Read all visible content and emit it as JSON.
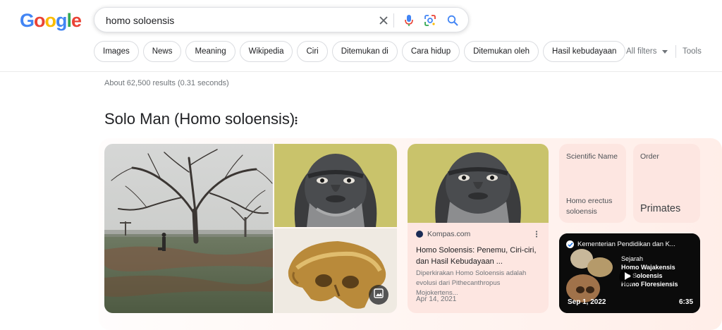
{
  "logo": {
    "letters": [
      "G",
      "o",
      "o",
      "g",
      "l",
      "e"
    ],
    "colors": [
      "#4285f4",
      "#ea4335",
      "#fbbc05",
      "#4285f4",
      "#34a853",
      "#ea4335"
    ]
  },
  "search": {
    "query": "homo soloensis"
  },
  "chips": [
    "Images",
    "News",
    "Meaning",
    "Wikipedia",
    "Ciri",
    "Ditemukan di",
    "Cara hidup",
    "Ditemukan oleh",
    "Hasil kebudayaan"
  ],
  "toolbar": {
    "all_filters": "All filters",
    "tools": "Tools"
  },
  "stats": "About 62,500 results (0.31 seconds)",
  "knowledge_panel": {
    "title": "Solo Man (Homo soloensis)",
    "article": {
      "source": "Kompas.com",
      "title": "Homo Soloensis: Penemu, Ciri-ciri, dan Hasil Kebudayaan ...",
      "snippet": "Diperkirakan Homo Soloensis adalah evolusi dari Pithecanthropus Mojokertens...",
      "date": "Apr 14, 2021"
    },
    "tiles": [
      {
        "label": "Scientific Name",
        "value": "Homo erectus soloensis"
      },
      {
        "label": "Order",
        "value": "Primates"
      }
    ],
    "video": {
      "channel": "Kementerian Pendidikan dan K...",
      "overlay_lines": [
        "Sejarah",
        "Homo Wajakensis",
        "o Soloensis",
        "Homo Floresiensis"
      ],
      "date": "Sep 1, 2022",
      "duration": "6:35"
    }
  }
}
